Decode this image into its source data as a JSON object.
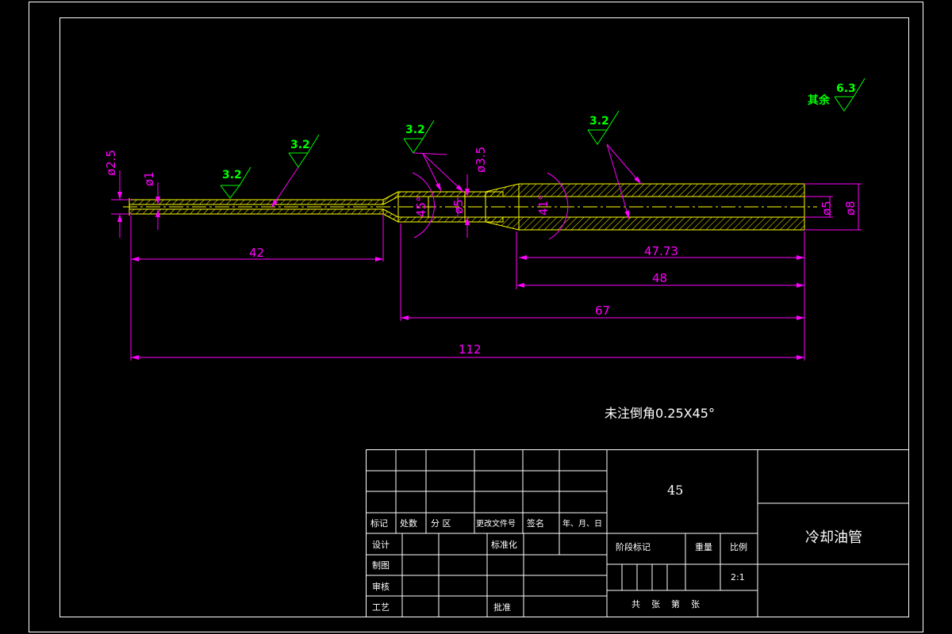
{
  "dimensions": {
    "d_left": "ø2.5",
    "d_left_bore": "ø1",
    "d_mid": "ø3.5",
    "d_mid_bore": "ø5",
    "angle_left": "45°",
    "angle_right": "41°",
    "d_right_bore": "ø5",
    "d_right": "ø8",
    "len_42": "42",
    "len_4773": "47.73",
    "len_48": "48",
    "len_67": "67",
    "len_112": "112"
  },
  "roughness": {
    "r1": "3.2",
    "r2": "3.2",
    "r3": "3.2",
    "r4": "3.2",
    "other_label": "其余",
    "other_value": "6.3"
  },
  "note": "未注倒角0.25X45°",
  "title_block": {
    "material": "45",
    "part_name": "冷却油管",
    "headers": [
      "标记",
      "处数",
      "分 区",
      "更改文件号",
      "签名",
      "年、月、日"
    ],
    "rows": [
      "设计",
      "制图",
      "审核",
      "工艺"
    ],
    "standardize": "标准化",
    "approve": "批准",
    "stage_mark": "阶段标记",
    "weight": "重量",
    "scale_label": "比例",
    "scale_value": "2:1",
    "sheets": "共    张    第    张"
  },
  "colors": {
    "background": "#000000",
    "frame": "#ffffff",
    "dimension": "#ff00ff",
    "part": "#ffff00",
    "roughness": "#00ff00"
  }
}
